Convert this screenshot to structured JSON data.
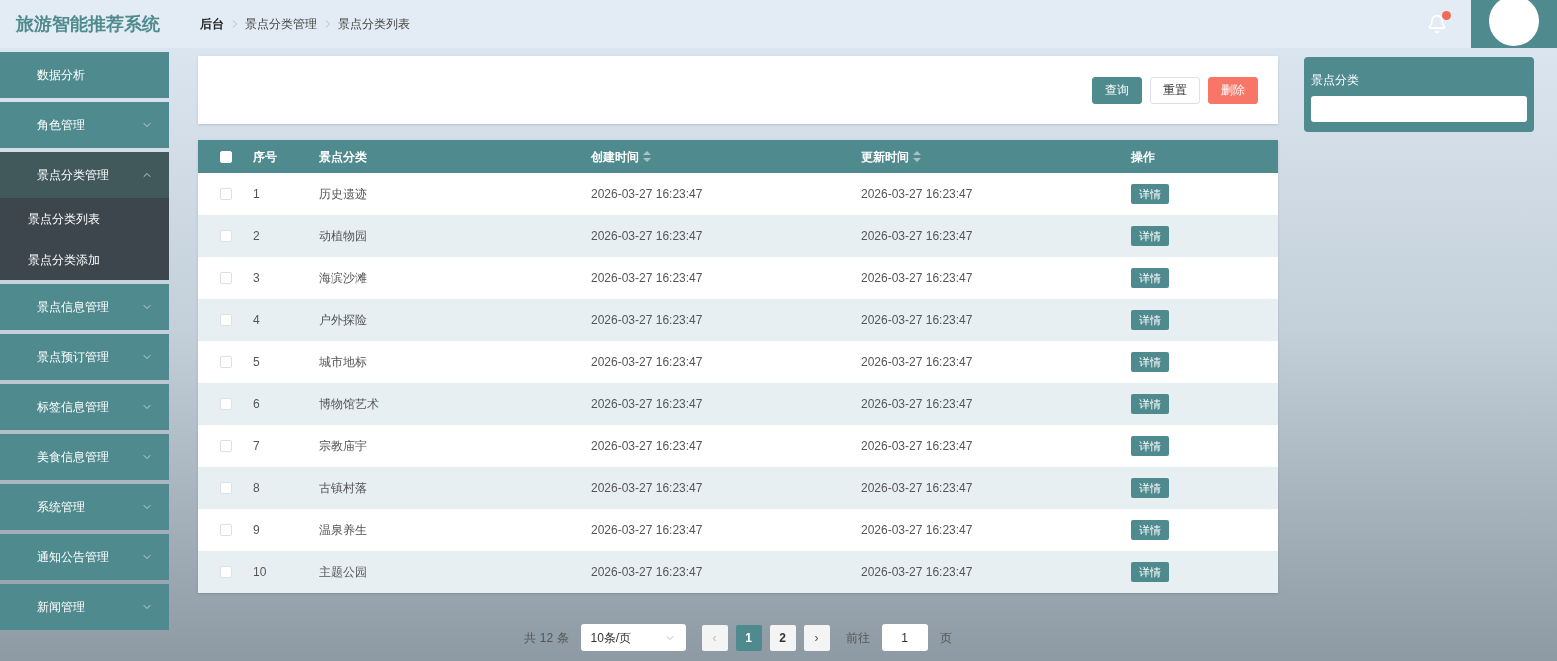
{
  "header": {
    "title": "旅游智能推荐系统",
    "breadcrumb": [
      "后台",
      "景点分类管理",
      "景点分类列表"
    ],
    "notification_badge": true
  },
  "sidebar": {
    "items": [
      {
        "label": "数据分析",
        "expandable": false,
        "expanded": false
      },
      {
        "label": "角色管理",
        "expandable": true,
        "expanded": false
      },
      {
        "label": "景点分类管理",
        "expandable": true,
        "expanded": true,
        "children": [
          {
            "label": "景点分类列表"
          },
          {
            "label": "景点分类添加"
          }
        ]
      },
      {
        "label": "景点信息管理",
        "expandable": true,
        "expanded": false
      },
      {
        "label": "景点预订管理",
        "expandable": true,
        "expanded": false
      },
      {
        "label": "标签信息管理",
        "expandable": true,
        "expanded": false
      },
      {
        "label": "美食信息管理",
        "expandable": true,
        "expanded": false
      },
      {
        "label": "系统管理",
        "expandable": true,
        "expanded": false
      },
      {
        "label": "通知公告管理",
        "expandable": true,
        "expanded": false
      },
      {
        "label": "新闻管理",
        "expandable": true,
        "expanded": false
      }
    ]
  },
  "toolbar": {
    "buttons": [
      {
        "label": "查询",
        "kind": "primary"
      },
      {
        "label": "重置",
        "kind": "plain"
      },
      {
        "label": "删除",
        "kind": "danger"
      }
    ]
  },
  "table": {
    "columns": [
      {
        "label": "序号",
        "sortable": false
      },
      {
        "label": "景点分类",
        "sortable": false
      },
      {
        "label": "创建时间",
        "sortable": true
      },
      {
        "label": "更新时间",
        "sortable": true
      },
      {
        "label": "操作",
        "sortable": false
      }
    ],
    "all_checked": false,
    "rows": [
      {
        "checked": false,
        "cells": [
          "1",
          "历史遗迹",
          "2026-03-27 16:23:47",
          "2026-03-27 16:23:47"
        ],
        "action": "详情"
      },
      {
        "checked": false,
        "cells": [
          "2",
          "动植物园",
          "2026-03-27 16:23:47",
          "2026-03-27 16:23:47"
        ],
        "action": "详情"
      },
      {
        "checked": false,
        "cells": [
          "3",
          "海滨沙滩",
          "2026-03-27 16:23:47",
          "2026-03-27 16:23:47"
        ],
        "action": "详情"
      },
      {
        "checked": false,
        "cells": [
          "4",
          "户外探险",
          "2026-03-27 16:23:47",
          "2026-03-27 16:23:47"
        ],
        "action": "详情"
      },
      {
        "checked": false,
        "cells": [
          "5",
          "城市地标",
          "2026-03-27 16:23:47",
          "2026-03-27 16:23:47"
        ],
        "action": "详情"
      },
      {
        "checked": false,
        "cells": [
          "6",
          "博物馆艺术",
          "2026-03-27 16:23:47",
          "2026-03-27 16:23:47"
        ],
        "action": "详情"
      },
      {
        "checked": false,
        "cells": [
          "7",
          "宗教庙宇",
          "2026-03-27 16:23:47",
          "2026-03-27 16:23:47"
        ],
        "action": "详情"
      },
      {
        "checked": false,
        "cells": [
          "8",
          "古镇村落",
          "2026-03-27 16:23:47",
          "2026-03-27 16:23:47"
        ],
        "action": "详情"
      },
      {
        "checked": false,
        "cells": [
          "9",
          "温泉养生",
          "2026-03-27 16:23:47",
          "2026-03-27 16:23:47"
        ],
        "action": "详情"
      },
      {
        "checked": false,
        "cells": [
          "10",
          "主题公园",
          "2026-03-27 16:23:47",
          "2026-03-27 16:23:47"
        ],
        "action": "详情"
      }
    ]
  },
  "pagination": {
    "total": "共 12 条",
    "page_size": "10条/页",
    "prev": "‹",
    "pages": [
      {
        "label": "1",
        "selected": true
      },
      {
        "label": "2",
        "selected": false
      }
    ],
    "next": "›",
    "goto_label": "前往",
    "goto_value": "1",
    "goto_suffix": "页"
  },
  "filter_panel": {
    "label": "景点分类"
  }
}
